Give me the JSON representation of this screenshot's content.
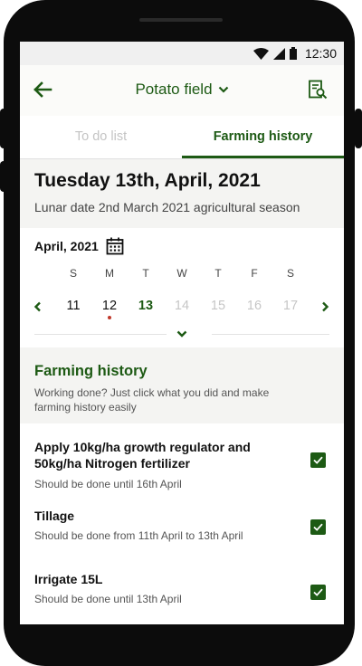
{
  "statusbar": {
    "time": "12:30",
    "icons": [
      "wifi-icon",
      "signal-icon",
      "battery-icon"
    ]
  },
  "appbar": {
    "title": "Potato field",
    "back_icon": "arrow-left-icon",
    "title_icon": "chevron-down-icon",
    "action_icon": "report-search-icon"
  },
  "tabs": [
    {
      "label": "To do list",
      "active": false
    },
    {
      "label": "Farming history",
      "active": true
    }
  ],
  "date_header": {
    "title": "Tuesday 13th, April, 2021",
    "lunar": "Lunar date 2nd March 2021 agricultural season"
  },
  "calendar": {
    "month": "April, 2021",
    "weekdays": [
      "S",
      "M",
      "T",
      "W",
      "T",
      "F",
      "S"
    ],
    "days": [
      {
        "label": "11",
        "state": "past"
      },
      {
        "label": "12",
        "state": "past",
        "has_event": true
      },
      {
        "label": "13",
        "state": "today"
      },
      {
        "label": "14",
        "state": "future"
      },
      {
        "label": "15",
        "state": "future"
      },
      {
        "label": "16",
        "state": "future"
      },
      {
        "label": "17",
        "state": "future"
      }
    ]
  },
  "history": {
    "title": "Farming history",
    "description": "Working done? Just click what you did and make farming history easily"
  },
  "tasks": [
    {
      "title": "Apply 10kg/ha growth regulator and 50kg/ha Nitrogen fertilizer",
      "subtitle": "Should be done until 16th April",
      "checked": true
    },
    {
      "title": "Tillage",
      "subtitle": "Should be done from 11th April to 13th April",
      "checked": true
    },
    {
      "title": "Irrigate 15L",
      "subtitle": "Should be done until 13th April",
      "checked": true
    }
  ],
  "colors": {
    "accent": "#1d5a14",
    "event_dot": "#c0392b",
    "frame": "#0c0c0c"
  }
}
